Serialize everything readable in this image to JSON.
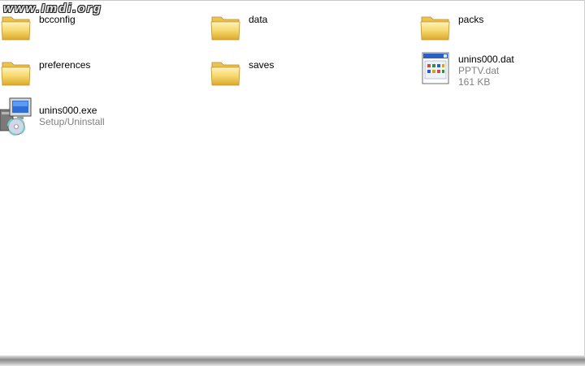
{
  "watermark": "www.Imdi.org",
  "items": [
    {
      "name": "bcconfig",
      "icon": "folder-icon"
    },
    {
      "name": "data",
      "icon": "folder-icon"
    },
    {
      "name": "packs",
      "icon": "folder-icon"
    },
    {
      "name": "preferences",
      "icon": "folder-icon"
    },
    {
      "name": "saves",
      "icon": "folder-icon"
    },
    {
      "name": "unins000.dat",
      "type": "PPTV.dat",
      "size": "161 KB",
      "icon": "dat-file-icon"
    },
    {
      "name": "unins000.exe",
      "type": "Setup/Uninstall",
      "icon": "setup-exe-icon"
    }
  ],
  "colors": {
    "folder": "#f6d66a",
    "folder_shadow": "#d9a92e",
    "detail_text": "#808080"
  }
}
